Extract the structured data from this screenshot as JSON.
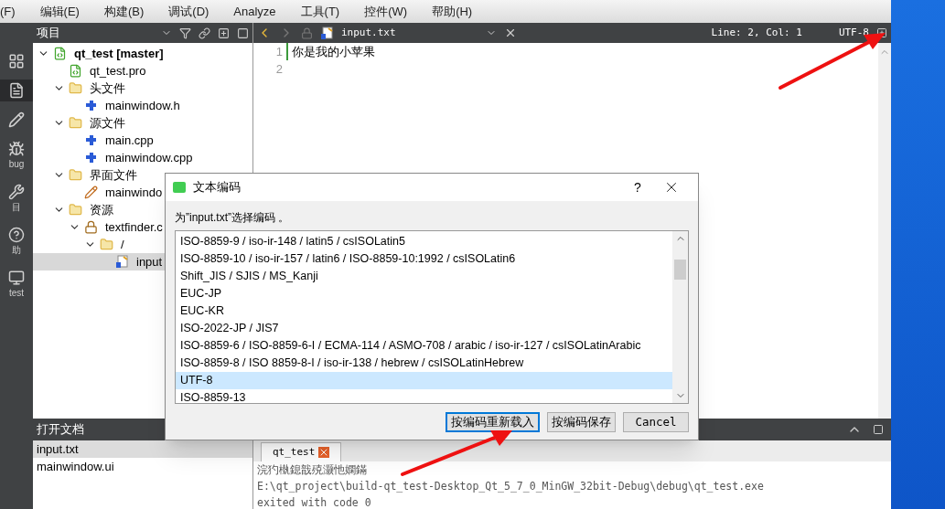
{
  "menu_bar": [
    "(F)",
    "编辑(E)",
    "构建(B)",
    "调试(D)",
    "Analyze",
    "工具(T)",
    "控件(W)",
    "帮助(H)"
  ],
  "mode_bar": [
    {
      "kind": "grid",
      "selected": false
    },
    {
      "kind": "edit",
      "selected": true
    },
    {
      "kind": "design",
      "selected": false
    },
    {
      "label": "bug",
      "kind": "bug",
      "selected": false
    },
    {
      "label": "目",
      "kind": "wrench",
      "selected": false
    },
    {
      "label": "助",
      "kind": "help",
      "selected": false
    },
    {
      "label": "test",
      "kind": "monitor",
      "selected": false
    }
  ],
  "project_panel": {
    "title": "项目",
    "tree": [
      {
        "label": "qt_test [master]",
        "kind": "project",
        "selected": false,
        "expanded": true,
        "children": [
          {
            "label": "qt_test.pro",
            "kind": "pro",
            "selected": false
          },
          {
            "label": "头文件",
            "kind": "folder-h",
            "selected": false,
            "expanded": true,
            "children": [
              {
                "label": "mainwindow.h",
                "kind": "source",
                "selected": false
              }
            ]
          },
          {
            "label": "源文件",
            "kind": "folder-cpp",
            "selected": false,
            "expanded": true,
            "children": [
              {
                "label": "main.cpp",
                "kind": "source",
                "selected": false
              },
              {
                "label": "mainwindow.cpp",
                "kind": "source",
                "selected": false
              }
            ]
          },
          {
            "label": "界面文件",
            "kind": "folder-ui",
            "selected": false,
            "expanded": true,
            "children": [
              {
                "label": "mainwindo",
                "kind": "ui",
                "selected": false
              }
            ]
          },
          {
            "label": "资源",
            "kind": "folder-res",
            "selected": false,
            "expanded": true,
            "children": [
              {
                "label": "textfinder.c",
                "kind": "qrc",
                "selected": false,
                "expanded": true,
                "children": [
                  {
                    "label": "/",
                    "kind": "folder",
                    "selected": false,
                    "expanded": true,
                    "children": [
                      {
                        "label": "input",
                        "kind": "text",
                        "selected": true
                      }
                    ]
                  }
                ]
              }
            ]
          }
        ]
      }
    ]
  },
  "open_documents": {
    "title": "打开文档",
    "items": [
      {
        "label": "input.txt",
        "selected": true
      },
      {
        "label": "mainwindow.ui",
        "selected": false
      }
    ]
  },
  "editor": {
    "file": "input.txt",
    "position": "Line: 2, Col: 1",
    "encoding": "UTF-8",
    "lines": [
      {
        "number": "1",
        "text": "你是我的小苹果"
      },
      {
        "number": "2"
      }
    ]
  },
  "output": {
    "tabs": [
      {
        "label": "qt_test",
        "selected": true
      }
    ],
    "lines": [
      "浣犳槸鎴戠殑灏忚嫻鏋",
      "E:\\qt_project\\build-qt_test-Desktop_Qt_5_7_0_MinGW_32bit-Debug\\debug\\qt_test.exe",
      "exited with code 0"
    ]
  },
  "dialog": {
    "title": "文本编码",
    "help": "?",
    "prompt": "为”input.txt”选择编码 。",
    "encodings": [
      {
        "label": "ISO-8859-9 / iso-ir-148 / latin5 / csISOLatin5",
        "selected": false
      },
      {
        "label": "ISO-8859-10 / iso-ir-157 / latin6 / ISO-8859-10:1992 / csISOLatin6",
        "selected": false
      },
      {
        "label": "Shift_JIS / SJIS / MS_Kanji",
        "selected": false
      },
      {
        "label": "EUC-JP",
        "selected": false
      },
      {
        "label": "EUC-KR",
        "selected": false
      },
      {
        "label": "ISO-2022-JP / JIS7",
        "selected": false
      },
      {
        "label": "ISO-8859-6 / ISO-8859-6-I / ECMA-114 / ASMO-708 / arabic / iso-ir-127 / csISOLatinArabic",
        "selected": false
      },
      {
        "label": "ISO-8859-8 / ISO 8859-8-I / iso-ir-138 / hebrew / csISOLatinHebrew",
        "selected": false
      },
      {
        "label": "UTF-8",
        "selected": true
      },
      {
        "label": "ISO-8859-13",
        "selected": false
      }
    ],
    "buttons": [
      {
        "label": "按编码重新载入",
        "default": true
      },
      {
        "label": "按编码保存",
        "default": false
      },
      {
        "label": "Cancel",
        "default": false
      }
    ]
  }
}
